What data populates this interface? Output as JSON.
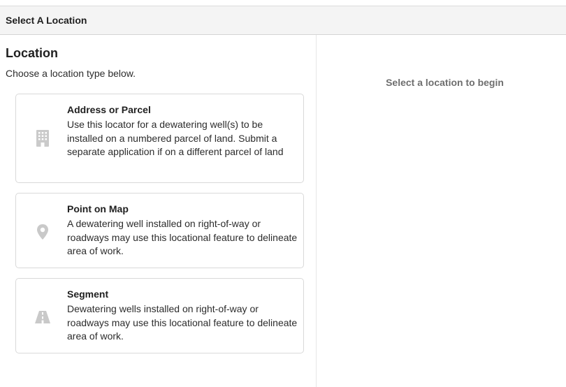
{
  "header": {
    "title": "Select A Location"
  },
  "location": {
    "title": "Location",
    "subtitle": "Choose a location type below.",
    "options": [
      {
        "title": "Address or Parcel",
        "description": "Use this locator for a dewatering well(s) to be installed on a numbered parcel of land. Submit a separate application if on a different parcel of land",
        "icon": "building-icon"
      },
      {
        "title": "Point on Map",
        "description": "A dewatering well installed on right-of-way or roadways may use this locational feature to delineate area of work.",
        "icon": "map-pin-icon"
      },
      {
        "title": "Segment",
        "description": "Dewatering wells installed on right-of-way or roadways may use this locational feature to delineate area of work.",
        "icon": "road-icon"
      }
    ]
  },
  "right_panel": {
    "message": "Select a location to begin"
  },
  "colors": {
    "icon": "#c9c9c9",
    "header_bg": "#f4f4f4",
    "border": "#d9d9d9"
  }
}
